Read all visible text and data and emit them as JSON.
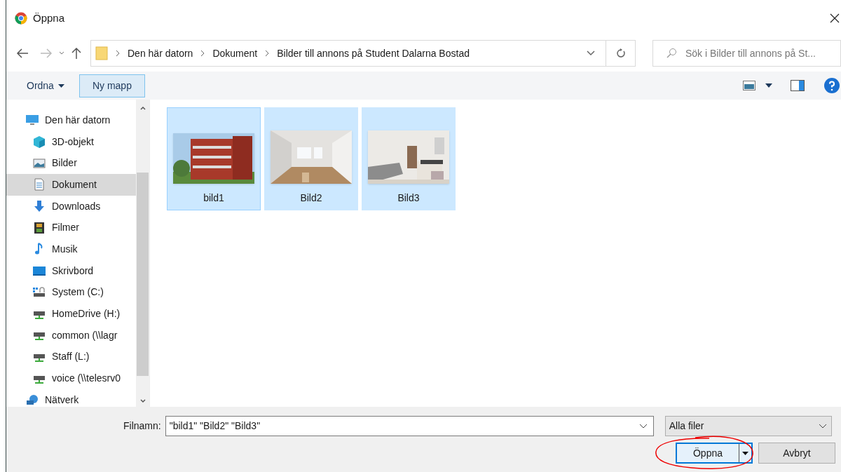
{
  "window": {
    "title": "Öppna"
  },
  "address_bar": {
    "crumbs": [
      "Den här datorn",
      "Dokument",
      "Bilder till annons på Student Dalarna Bostad"
    ]
  },
  "search": {
    "placeholder": "Sök i Bilder till annons på St..."
  },
  "toolbar": {
    "organize": "Ordna",
    "new_folder": "Ny mapp"
  },
  "sidebar": {
    "items": [
      {
        "label": "Den här datorn",
        "kind": "computer",
        "selected": false
      },
      {
        "label": "3D-objekt",
        "kind": "cube",
        "selected": false
      },
      {
        "label": "Bilder",
        "kind": "pictures",
        "selected": false
      },
      {
        "label": "Dokument",
        "kind": "document",
        "selected": true
      },
      {
        "label": "Downloads",
        "kind": "download",
        "selected": false
      },
      {
        "label": "Filmer",
        "kind": "film",
        "selected": false
      },
      {
        "label": "Musik",
        "kind": "music",
        "selected": false
      },
      {
        "label": "Skrivbord",
        "kind": "desktop",
        "selected": false
      },
      {
        "label": "System (C:)",
        "kind": "system",
        "selected": false
      },
      {
        "label": "HomeDrive (H:)",
        "kind": "drive",
        "selected": false
      },
      {
        "label": "common (\\\\lagr",
        "kind": "drive",
        "selected": false
      },
      {
        "label": "Staff (L:)",
        "kind": "drive",
        "selected": false
      },
      {
        "label": "voice (\\\\telesrv0",
        "kind": "drive",
        "selected": false
      },
      {
        "label": "Nätverk",
        "kind": "network",
        "selected": false
      }
    ]
  },
  "files": [
    {
      "name": "bild1",
      "kind": "picture",
      "selected": true,
      "focused": true
    },
    {
      "name": "Bild2",
      "kind": "picture",
      "selected": true,
      "focused": false
    },
    {
      "name": "Bild3",
      "kind": "picture",
      "selected": true,
      "focused": false
    }
  ],
  "footer": {
    "filename_label": "Filnamn:",
    "filename": "\"bild1\" \"Bild2\" \"Bild3\"",
    "filter": "Alla filer",
    "open": "Öppna",
    "cancel": "Avbryt"
  }
}
